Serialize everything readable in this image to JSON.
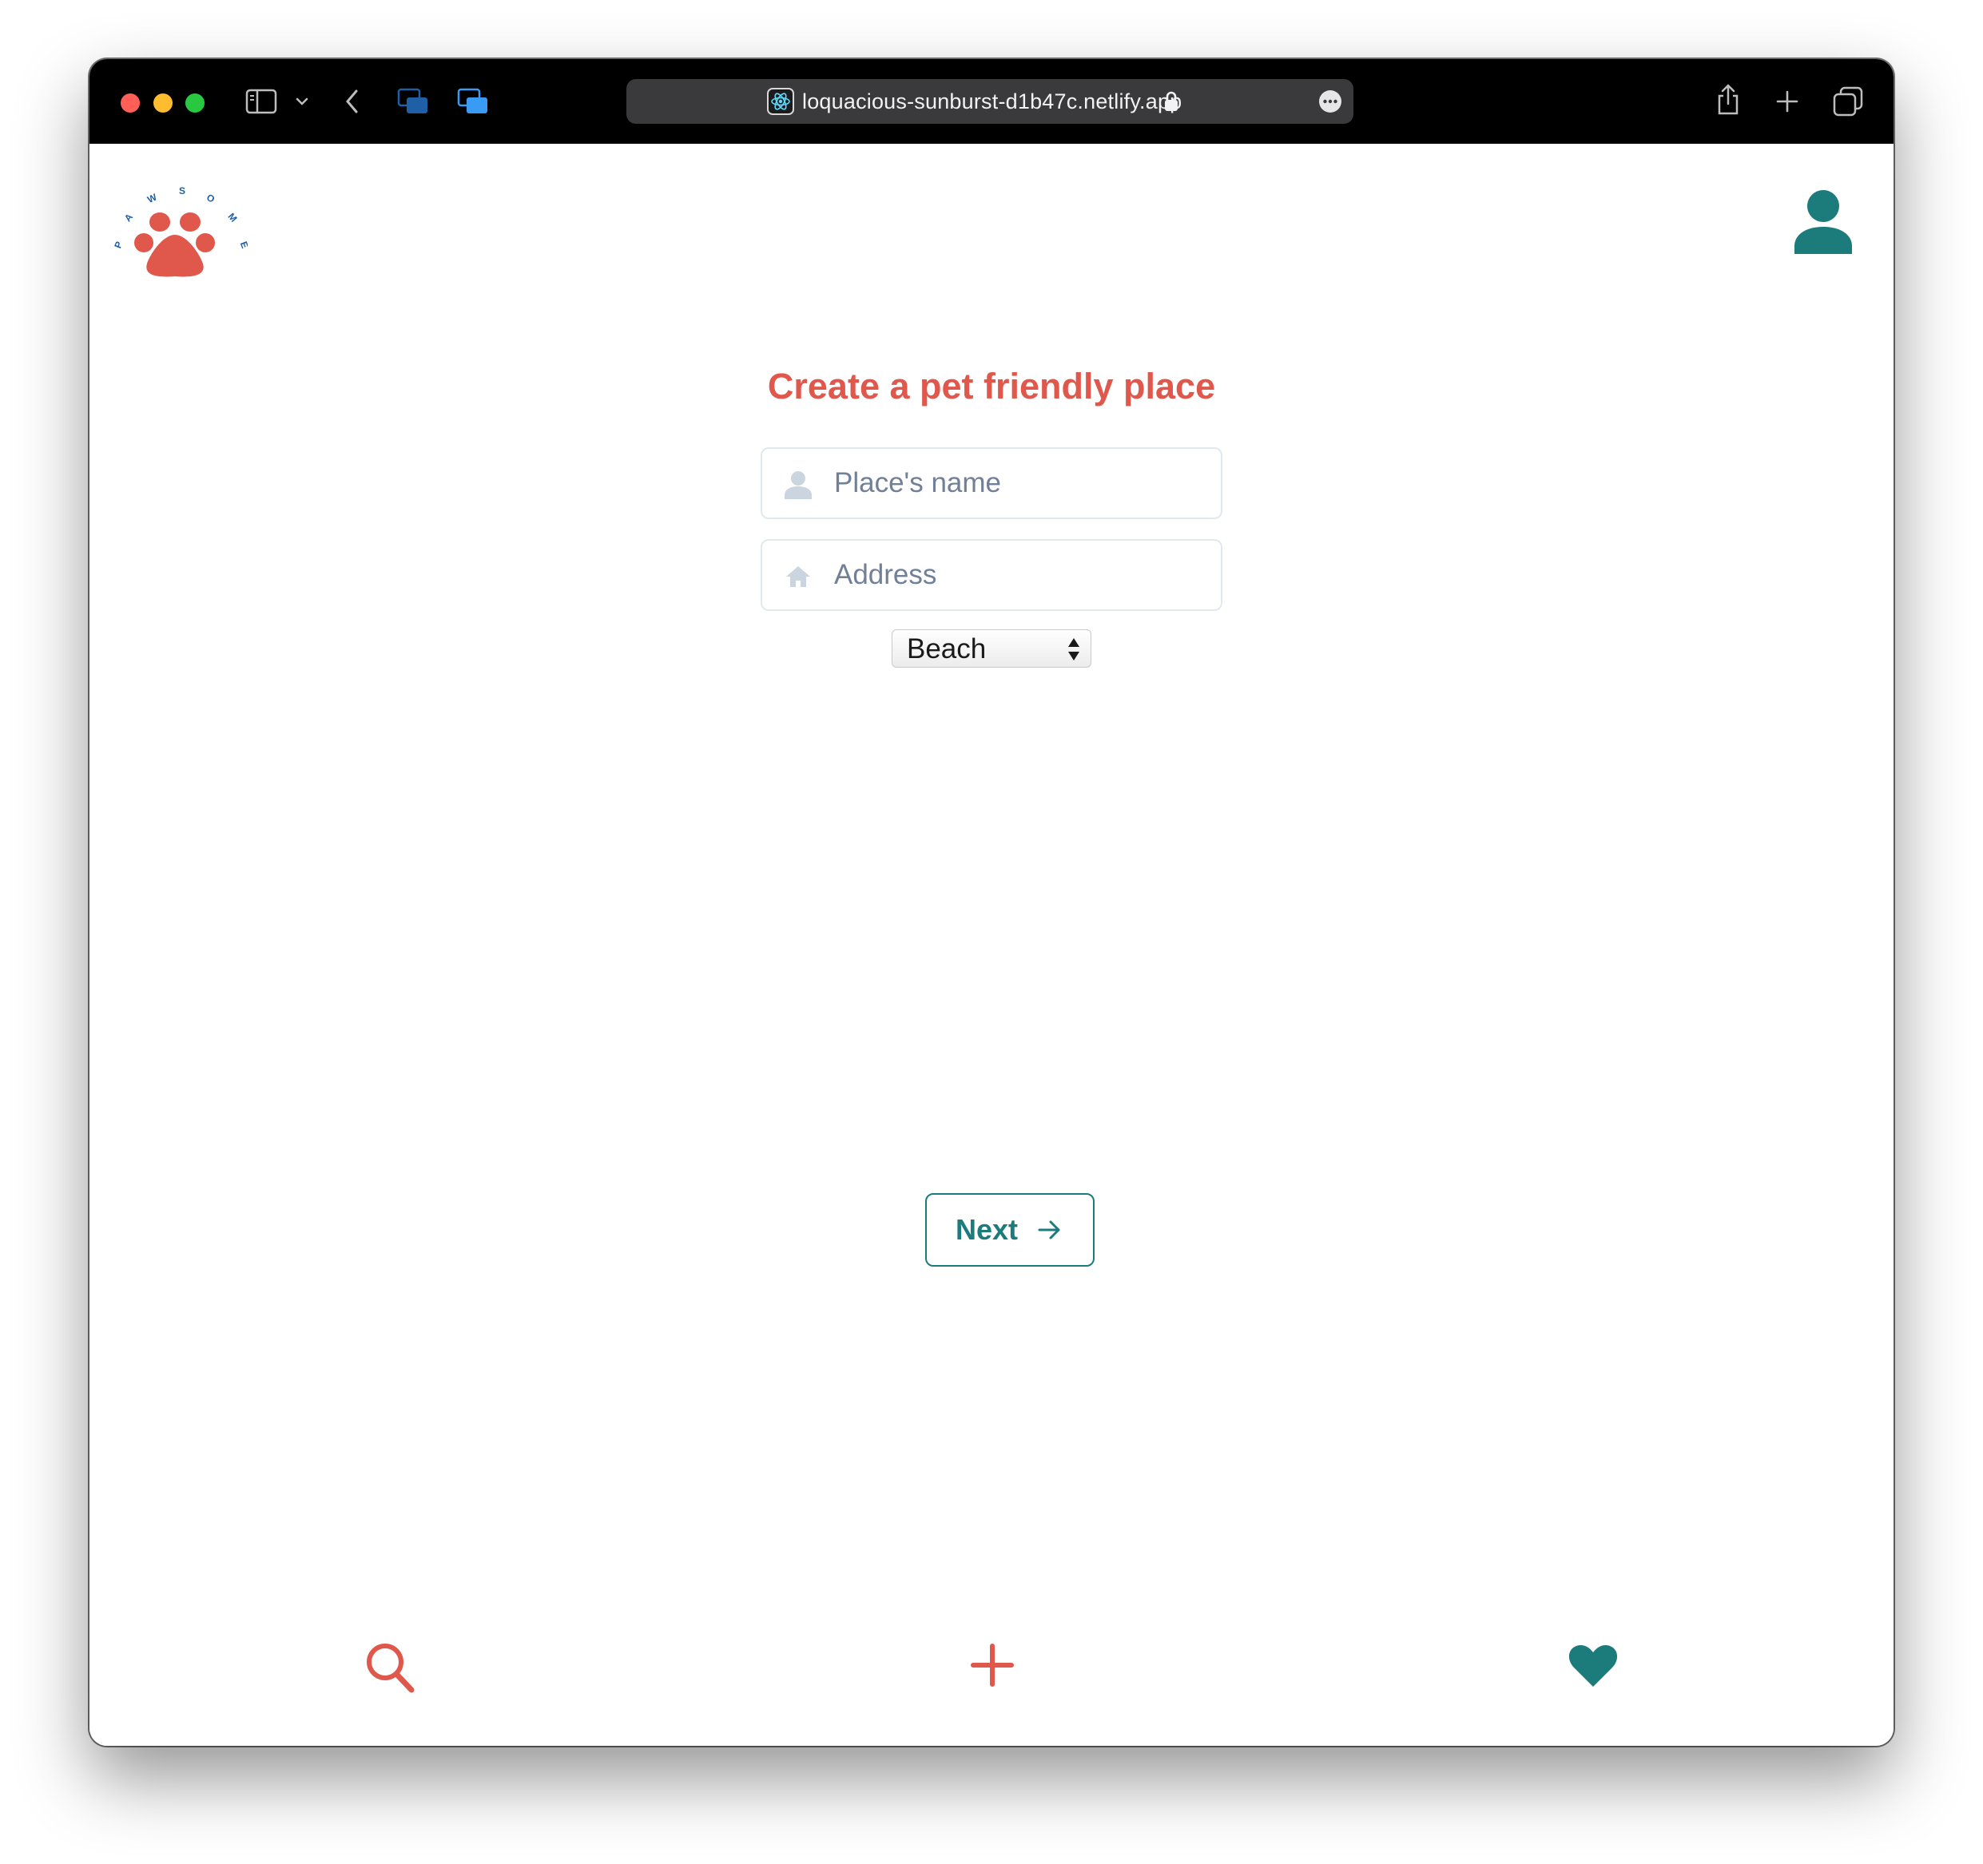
{
  "browser": {
    "url": "loquacious-sunburst-d1b47c.netlify.app",
    "icons": [
      "close-dot",
      "minimize-dot",
      "zoom-dot",
      "sidebar-icon",
      "chevron-down-icon",
      "back-icon",
      "tab-group-icon",
      "tab-group-active-icon",
      "react-favicon",
      "lock-icon",
      "more-icon",
      "share-icon",
      "plus-icon",
      "tabs-overview-icon"
    ]
  },
  "header": {
    "logo_text": "PAWSOME",
    "logo_icon": "paw-icon",
    "profile_icon": "user-icon"
  },
  "form": {
    "title": "Create a pet friendly place",
    "name_placeholder": "Place's name",
    "name_icon": "user-icon",
    "address_placeholder": "Address",
    "address_icon": "home-icon",
    "category_selected": "Beach",
    "next_label": "Next",
    "next_icon": "arrow-right-icon"
  },
  "bottom_nav": {
    "icons": [
      "search-icon",
      "plus-icon",
      "heart-icon"
    ]
  },
  "colors": {
    "accent_red": "#e0574c",
    "accent_teal": "#1c7c7c",
    "logo_blue": "#1f5fa6",
    "placeholder_icon": "#cbd5e0",
    "toolbar_bg": "#000000",
    "urlbar_bg": "#3a3a3c"
  }
}
